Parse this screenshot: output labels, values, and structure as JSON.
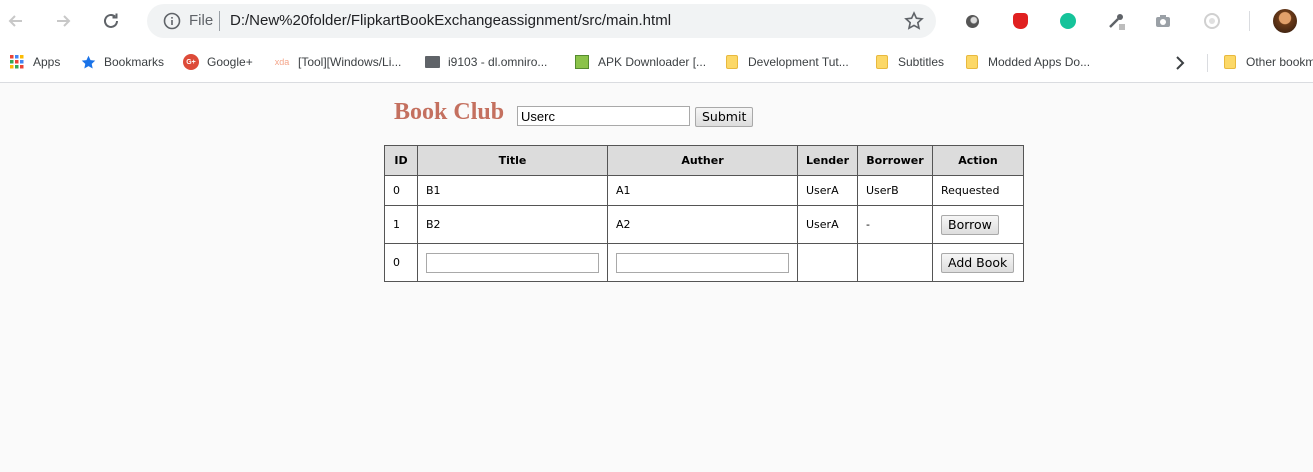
{
  "browser": {
    "url_scheme": "File",
    "url": "D:/New%20folder/FlipkartBookExchangeassignment/src/main.html",
    "bookmarks": [
      {
        "label": "Apps",
        "icon": "apps-grid-icon"
      },
      {
        "label": "Bookmarks",
        "icon": "star-bookmark-icon"
      },
      {
        "label": "Google+",
        "icon": "google-plus-icon"
      },
      {
        "label": "[Tool][Windows/Li...",
        "icon": "xda-icon"
      },
      {
        "label": "i9103 - dl.omniro...",
        "icon": "folder-dark-icon"
      },
      {
        "label": "APK Downloader [...",
        "icon": "apk-downloader-icon"
      },
      {
        "label": "Development Tut...",
        "icon": "folder-icon"
      },
      {
        "label": "Subtitles",
        "icon": "folder-icon"
      },
      {
        "label": "Modded Apps Do...",
        "icon": "folder-icon"
      }
    ],
    "other_bookmarks": "Other bookm",
    "favicon_google_plus": "G+",
    "favicon_xda": "xda"
  },
  "page": {
    "title": "Book Club",
    "user_value": "Userc",
    "submit_label": "Submit",
    "colors": {
      "title": "#c4705f",
      "header_bg": "#dcdcdc"
    }
  },
  "table": {
    "headers": [
      "ID",
      "Title",
      "Auther",
      "Lender",
      "Borrower",
      "Action"
    ],
    "rows": [
      {
        "id": "0",
        "title": "B1",
        "author": "A1",
        "lender": "UserA",
        "borrower": "UserB",
        "action": "Requested"
      },
      {
        "id": "1",
        "title": "B2",
        "author": "A2",
        "lender": "UserA",
        "borrower": "-",
        "action": "Borrow"
      }
    ],
    "new_row": {
      "id": "0",
      "title_value": "",
      "author_value": "",
      "action": "Add Book"
    }
  }
}
